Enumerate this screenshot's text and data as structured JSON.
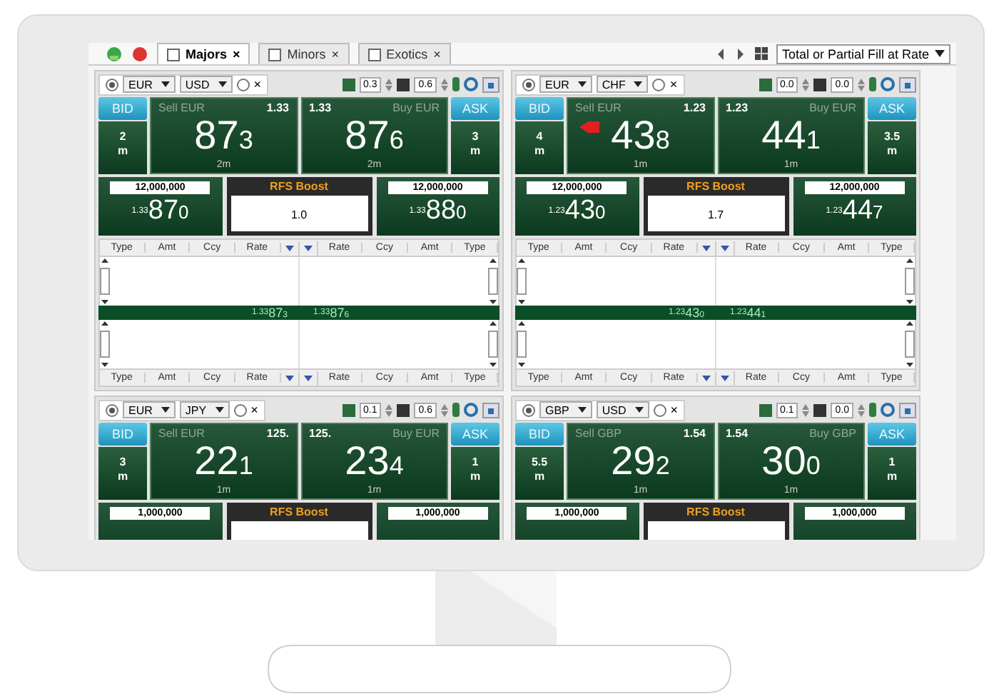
{
  "tabs": [
    {
      "label": "Majors",
      "close": "×",
      "selected": true
    },
    {
      "label": "Minors",
      "close": "×",
      "selected": false
    },
    {
      "label": "Exotics",
      "close": "×",
      "selected": false
    }
  ],
  "fill_mode": "Total or Partial Fill at Rate",
  "panels": [
    {
      "radios": [
        {
          "selected": true
        },
        {
          "selected": false
        }
      ],
      "base": "EUR",
      "quote": "USD",
      "close": "×",
      "step_1": "0.3",
      "step_2": "0.6",
      "bid": {
        "label": "BID",
        "size": "2",
        "unit": "m"
      },
      "sell": {
        "label": "Sell EUR",
        "prefix": "1.33",
        "pips": "87",
        "pipette": "3",
        "size": "2m",
        "flag": false
      },
      "buy": {
        "label": "Buy EUR",
        "prefix": "1.33",
        "pips": "87",
        "pipette": "6",
        "size": "2m"
      },
      "ask": {
        "label": "ASK",
        "size": "3",
        "unit": "m"
      },
      "sell_rfs": {
        "amount": "12,000,000",
        "prefix": "1.33",
        "pips": "87",
        "pipette": "0"
      },
      "boost": {
        "title": "RFS Boost",
        "value": "1.0"
      },
      "buy_rfs": {
        "amount": "12,000,000",
        "prefix": "1.33",
        "pips": "88",
        "pipette": "0"
      },
      "ladder": {
        "header_left": [
          "Type",
          "Amt",
          "Ccy",
          "Rate"
        ],
        "header_right": [
          "Rate",
          "Ccy",
          "Amt",
          "Type"
        ],
        "band_sell": {
          "prefix": "1.33",
          "pips": "87",
          "pipette": "3"
        },
        "band_buy": {
          "prefix": "1.33",
          "pips": "87",
          "pipette": "6"
        },
        "footer_left": [
          "Type",
          "Amt",
          "Ccy",
          "Rate"
        ],
        "footer_right": [
          "Rate",
          "Ccy",
          "Amt",
          "Type"
        ]
      }
    },
    {
      "radios": [
        {
          "selected": true
        },
        {
          "selected": false
        }
      ],
      "base": "EUR",
      "quote": "CHF",
      "close": "×",
      "step_1": "0.0",
      "step_2": "0.0",
      "bid": {
        "label": "BID",
        "size": "4",
        "unit": "m"
      },
      "sell": {
        "label": "Sell EUR",
        "prefix": "1.23",
        "pips": "43",
        "pipette": "8",
        "size": "1m",
        "flag": true
      },
      "buy": {
        "label": "Buy EUR",
        "prefix": "1.23",
        "pips": "44",
        "pipette": "1",
        "size": "1m"
      },
      "ask": {
        "label": "ASK",
        "size": "3.5",
        "unit": "m"
      },
      "sell_rfs": {
        "amount": "12,000,000",
        "prefix": "1.23",
        "pips": "43",
        "pipette": "0"
      },
      "boost": {
        "title": "RFS Boost",
        "value": "1.7"
      },
      "buy_rfs": {
        "amount": "12,000,000",
        "prefix": "1.23",
        "pips": "44",
        "pipette": "7"
      },
      "ladder": {
        "header_left": [
          "Type",
          "Amt",
          "Ccy",
          "Rate"
        ],
        "header_right": [
          "Rate",
          "Ccy",
          "Amt",
          "Type"
        ],
        "band_sell": {
          "prefix": "1.23",
          "pips": "43",
          "pipette": "0"
        },
        "band_buy": {
          "prefix": "1.23",
          "pips": "44",
          "pipette": "1"
        },
        "footer_left": [
          "Type",
          "Amt",
          "Ccy",
          "Rate"
        ],
        "footer_right": [
          "Rate",
          "Ccy",
          "Amt",
          "Type"
        ]
      }
    },
    {
      "radios": [
        {
          "selected": true
        },
        {
          "selected": false
        }
      ],
      "base": "EUR",
      "quote": "JPY",
      "close": "×",
      "step_1": "0.1",
      "step_2": "0.6",
      "bid": {
        "label": "BID",
        "size": "3",
        "unit": "m"
      },
      "sell": {
        "label": "Sell EUR",
        "prefix": "125.",
        "pips": "22",
        "pipette": "1",
        "size": "1m",
        "flag": false
      },
      "buy": {
        "label": "Buy EUR",
        "prefix": "125.",
        "pips": "23",
        "pipette": "4",
        "size": "1m"
      },
      "ask": {
        "label": "ASK",
        "size": "1",
        "unit": "m"
      },
      "sell_rfs": {
        "amount": "1,000,000"
      },
      "boost": {
        "title": "RFS Boost"
      },
      "buy_rfs": {
        "amount": "1,000,000"
      }
    },
    {
      "radios": [
        {
          "selected": true
        },
        {
          "selected": false
        }
      ],
      "base": "GBP",
      "quote": "USD",
      "close": "×",
      "step_1": "0.1",
      "step_2": "0.0",
      "bid": {
        "label": "BID",
        "size": "5.5",
        "unit": "m"
      },
      "sell": {
        "label": "Sell GBP",
        "prefix": "1.54",
        "pips": "29",
        "pipette": "2",
        "size": "1m",
        "flag": false
      },
      "buy": {
        "label": "Buy GBP",
        "prefix": "1.54",
        "pips": "30",
        "pipette": "0",
        "size": "1m"
      },
      "ask": {
        "label": "ASK",
        "size": "1",
        "unit": "m"
      },
      "sell_rfs": {
        "amount": "1,000,000"
      },
      "boost": {
        "title": "RFS Boost"
      },
      "buy_rfs": {
        "amount": "1,000,000"
      }
    }
  ]
}
